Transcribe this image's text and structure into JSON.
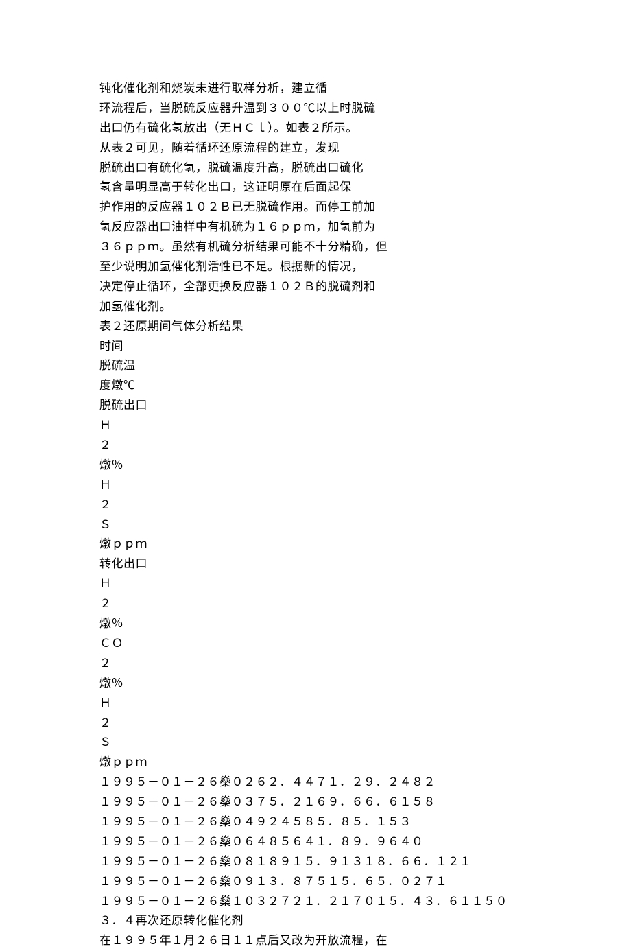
{
  "lines": [
    "钝化催化剂和烧炭未进行取样分析，建立循",
    "环流程后，当脱硫反应器升温到３００℃以上时脱硫",
    "出口仍有硫化氢放出（无ＨＣｌ）。如表２所示。",
    "从表２可见，随着循环还原流程的建立，发现",
    "脱硫出口有硫化氢，脱硫温度升高，脱硫出口硫化",
    "氢含量明显高于转化出口，这证明原在后面起保",
    "护作用的反应器１０２Ｂ已无脱硫作用。而停工前加",
    "氢反应器出口油样中有机硫为１６ｐｐｍ，加氢前为",
    "３６ｐｐｍ。虽然有机硫分析结果可能不十分精确，但",
    "至少说明加氢催化剂活性已不足。根据新的情况，",
    "决定停止循环，全部更换反应器１０２Ｂ的脱硫剂和",
    "加氢催化剂。",
    "表２还原期间气体分析结果",
    "时间",
    "脱硫温",
    "度燉℃",
    "脱硫出口",
    "Ｈ",
    "２",
    "燉％",
    "Ｈ",
    "２",
    "Ｓ",
    "燉ｐｐｍ",
    "转化出口",
    "Ｈ",
    "２",
    "燉％",
    "ＣＯ",
    "２",
    "燉％",
    "Ｈ",
    "２",
    "Ｓ",
    "燉ｐｐｍ",
    "１９９５－０１－２６燊０２６２．４４７１．２９．２４８２",
    "１９９５－０１－２６燊０３７５．２１６９．６６．６１５８",
    "１９９５－０１－２６燊０４９２４５８５．８５．１５３",
    "１９９５－０１－２６燊０６４８５６４１．８９．９６４０",
    "１９９５－０１－２６燊０８１８９１５．９１３１８．６６．１２１",
    "１９９５－０１－２６燊０９１３．８７５１５．６５．０２７１",
    "１９９５－０１－２６燊１０３２７２１．２１７０１５．４３．６１１５０",
    "３．４再次还原转化催化剂",
    "在１９９５年１月２６日１１点后又改为开放流程，在"
  ],
  "chart_data": {
    "type": "table",
    "title": "表２还原期间气体分析结果",
    "columns": [
      "时间",
      "脱硫温度/℃",
      "脱硫出口 H₂/%",
      "脱硫出口 H₂S/ppm",
      "转化出口 H₂/%",
      "转化出口 CO₂/%",
      "转化出口 H₂S/ppm"
    ],
    "rows": [
      [
        "1995-01-26 02",
        "62.4",
        "",
        "47",
        "1.2",
        "9.2",
        "482"
      ],
      [
        "1995-01-26 03",
        "75.2",
        "",
        "16",
        "9.6",
        "6.6",
        "158"
      ],
      [
        "1995-01-26 04",
        "92",
        "",
        "45",
        "85.8",
        "5.1",
        "53"
      ],
      [
        "1995-01-26 06",
        "485",
        "",
        "64",
        "1.8",
        "9.9",
        "640"
      ],
      [
        "1995-01-26 08",
        "189",
        "15.9",
        "13",
        "18.6",
        "6.1",
        "21"
      ],
      [
        "1995-01-26 09",
        "13.8",
        "",
        "75",
        "15.6",
        "5.0",
        "271"
      ],
      [
        "1995-01-26 10",
        "327",
        "21.2",
        "170",
        "15.4",
        "3.6",
        "1150"
      ]
    ]
  }
}
